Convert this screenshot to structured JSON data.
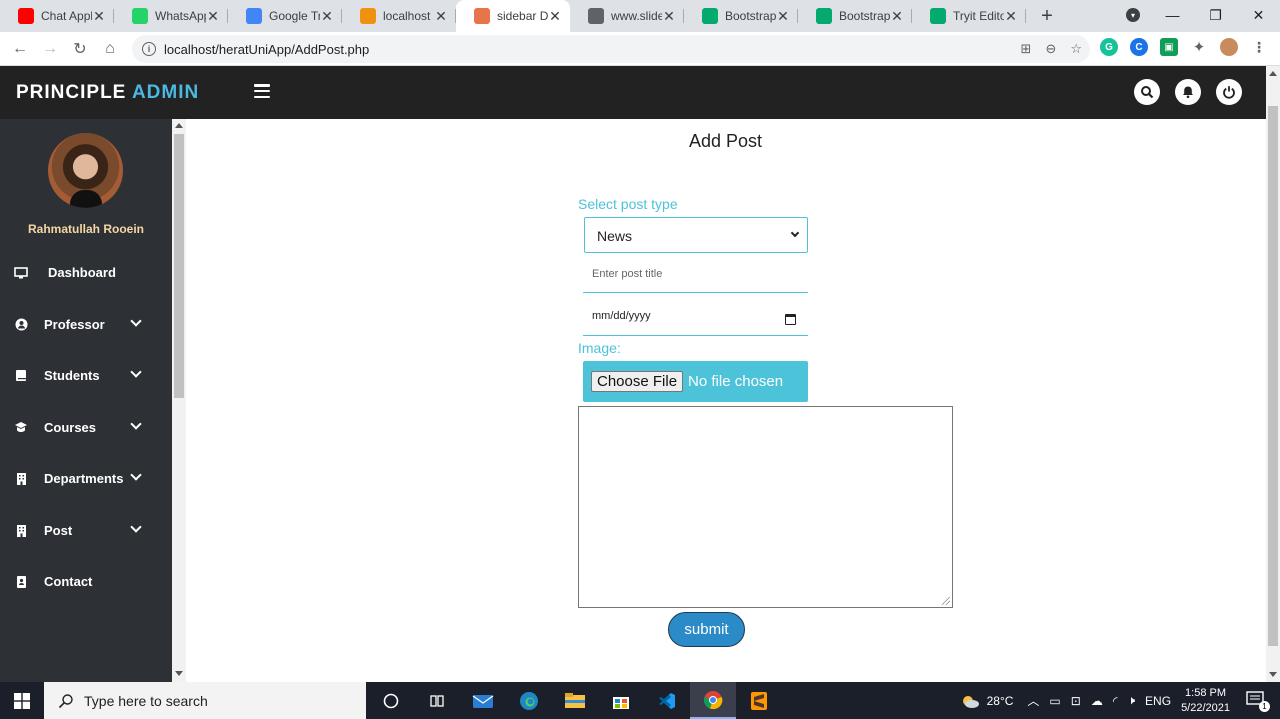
{
  "browser": {
    "tabs": [
      {
        "title": "Chat Applic",
        "favicon": "youtube-icon",
        "color": "#ff0000"
      },
      {
        "title": "WhatsApp",
        "favicon": "whatsapp-icon",
        "color": "#25d366"
      },
      {
        "title": "Google Tra",
        "favicon": "google-translate-icon",
        "color": "#4285f4"
      },
      {
        "title": "localhost / ",
        "favicon": "phpmyadmin-icon",
        "color": "#f29111"
      },
      {
        "title": "sidebar Da",
        "favicon": "codepen-icon",
        "color": "#e8744b",
        "active": true
      },
      {
        "title": "www.slides",
        "favicon": "globe-icon",
        "color": "#5f6368"
      },
      {
        "title": "Bootstrap ",
        "favicon": "w3schools-icon",
        "color": "#04aa6d"
      },
      {
        "title": "Bootstrap ",
        "favicon": "w3schools-icon",
        "color": "#04aa6d"
      },
      {
        "title": "Tryit Editor",
        "favicon": "w3schools-icon",
        "color": "#04aa6d"
      }
    ],
    "url": "localhost/heratUniApp/AddPost.php"
  },
  "header": {
    "brand_primary": "PRINCIPLE",
    "brand_accent": "ADMIN",
    "accent_color": "#4cb8e0"
  },
  "sidebar": {
    "username": "Rahmatullah Rooein",
    "items": [
      {
        "label": "Dashboard",
        "icon": "monitor-icon",
        "dropdown": false
      },
      {
        "label": "Professor",
        "icon": "user-circle-icon",
        "dropdown": true
      },
      {
        "label": "Students",
        "icon": "book-icon",
        "dropdown": true
      },
      {
        "label": "Courses",
        "icon": "graduation-icon",
        "dropdown": true
      },
      {
        "label": "Departments",
        "icon": "building-icon",
        "dropdown": true
      },
      {
        "label": "Post",
        "icon": "building-icon",
        "dropdown": true
      },
      {
        "label": "Contact",
        "icon": "address-book-icon",
        "dropdown": false
      }
    ]
  },
  "form": {
    "title": "Add Post",
    "post_type_label": "Select post type",
    "post_type_value": "News",
    "title_placeholder": "Enter post title",
    "date_placeholder": "mm/dd/yyyy",
    "image_label": "Image:",
    "file_button": "Choose File",
    "file_status": "No file chosen",
    "body_value": "",
    "submit_label": "submit",
    "accent_color": "#4cc3d9"
  },
  "taskbar": {
    "search_placeholder": "Type here to search",
    "weather": "28°C",
    "language": "ENG",
    "time": "1:58 PM",
    "date": "5/22/2021",
    "notification_count": "1"
  }
}
